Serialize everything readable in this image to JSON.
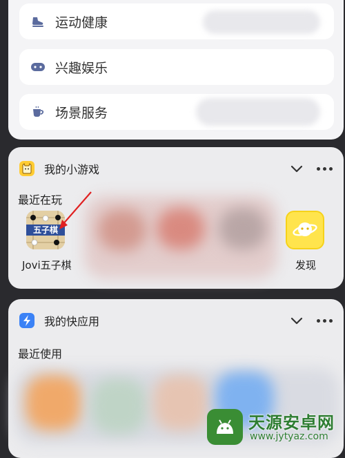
{
  "menu": {
    "items": [
      {
        "label": "运动健康",
        "icon": "running-shoe-icon"
      },
      {
        "label": "兴趣娱乐",
        "icon": "gamepad-icon"
      },
      {
        "label": "场景服务",
        "icon": "coffee-cup-icon"
      }
    ]
  },
  "games": {
    "title": "我的小游戏",
    "section_label": "最近在玩",
    "recent": [
      {
        "label": "Jovi五子棋",
        "tile_text": "五子棋",
        "icon": "gomoku-game-icon"
      }
    ],
    "discover_label": "发现",
    "discover_icon": "planet-smiley-icon"
  },
  "apps": {
    "title": "我的快应用",
    "section_label": "最近使用"
  },
  "watermark": {
    "site_name": "天源安卓网",
    "url": "www.jytyaz.com"
  },
  "colors": {
    "menu_icon": "#5b6b9e",
    "games_icon_bg": "#ffcc33",
    "apps_icon_bg": "#3b82f6",
    "arrow": "#e02020",
    "discover_bg": "#ffe44d"
  }
}
